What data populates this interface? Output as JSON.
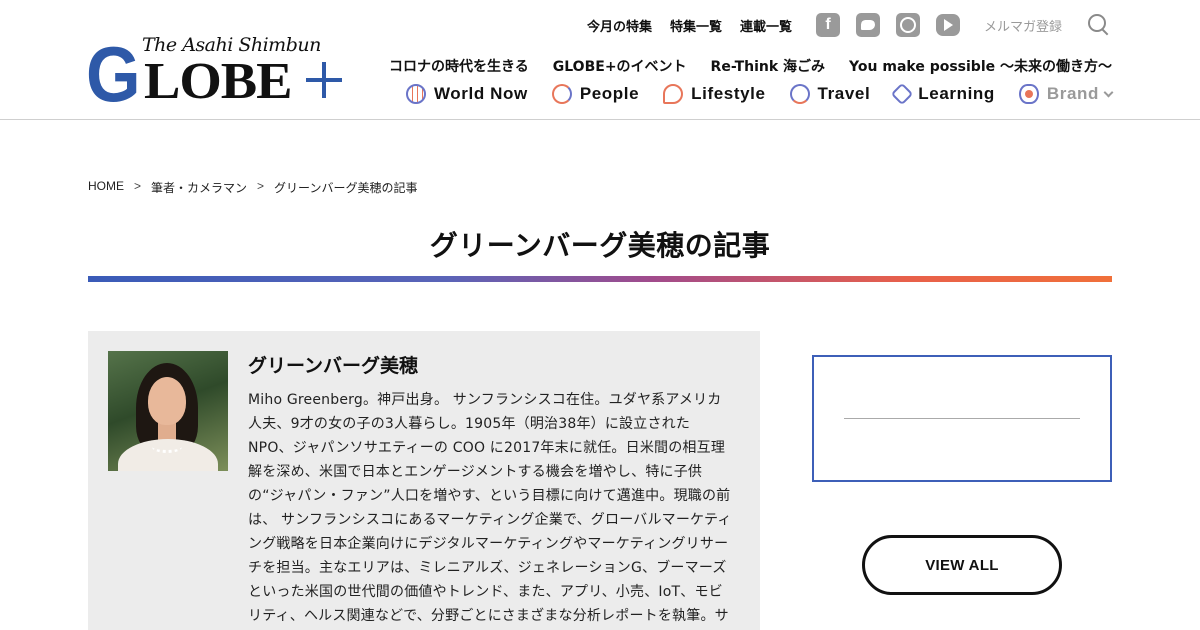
{
  "brand": {
    "tagline": "The Asahi Shimbun",
    "logo_letter": "G",
    "logo_rest": "LOBE"
  },
  "top_links": [
    "今月の特集",
    "特集一覧",
    "連載一覧"
  ],
  "social_icons": [
    "facebook-icon",
    "twitter-icon",
    "instagram-icon",
    "youtube-icon"
  ],
  "mail_magazine": "メルマガ登録",
  "special_links": [
    "コロナの時代を生きる",
    "GLOBE+のイベント",
    "Re-Think 海ごみ",
    "You make possible ～未来の働き方～"
  ],
  "nav": [
    {
      "label": "World Now",
      "icon": "globe-icon"
    },
    {
      "label": "People",
      "icon": "people-icon"
    },
    {
      "label": "Lifestyle",
      "icon": "lifestyle-icon"
    },
    {
      "label": "Travel",
      "icon": "travel-icon"
    },
    {
      "label": "Learning",
      "icon": "learning-icon"
    },
    {
      "label": "Brand",
      "icon": "brand-icon"
    }
  ],
  "breadcrumb": [
    "HOME",
    "筆者・カメラマン",
    "グリーンバーグ美穂の記事"
  ],
  "breadcrumb_sep": ">",
  "page_title": "グリーンバーグ美穂の記事",
  "colors": {
    "accent_blue": "#3d5fb8",
    "accent_orange": "#f0703a",
    "profile_bg": "#ececec"
  },
  "profile": {
    "name": "グリーンバーグ美穂",
    "bio": "Miho Greenberg。神戸出身。 サンフランシスコ在住。ユダヤ系アメリカ人夫、9才の女の子の3人暮らし。1905年（明治38年）に設立されたNPO、ジャパンソサエティーの COO に2017年末に就任。日米間の相互理解を深め、米国で日本とエンゲージメントする機会を増やし、特に子供の“ジャパン・ファン”人口を増やす、という目標に向けて邁進中。現職の前は、 サンフランシスコにあるマーケティング企業で、グローバルマーケティング戦略を日本企業向けにデジタルマーケティングやマーケティングリサーチを担当。主なエリアは、ミレニアルズ、ジェネレーションG、ブーマーズといった米国の世代間の価値やトレンド、また、アプリ、小売、IoT、モビリティ、ヘルス関連などで、分野ごとにさまざまな分析レポートを執筆。サンフランシス"
  },
  "view_all": "VIEW ALL"
}
